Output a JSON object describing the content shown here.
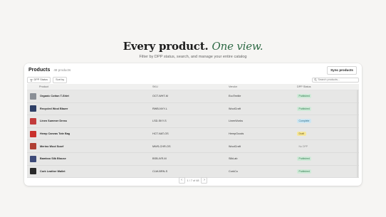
{
  "hero": {
    "title_main": "Every product.",
    "title_accent": "One view.",
    "subtitle": "Filter by DPP status, search, and manage your entire catalog"
  },
  "card": {
    "title": "Products",
    "count": "48 products",
    "sync_label": "Sync products",
    "filter_label": "DPP Status",
    "sort_label": "Sort by",
    "search_placeholder": "Search products..."
  },
  "table": {
    "headers": {
      "product": "Product",
      "sku": "SKU",
      "vendor": "Vendor",
      "status": "DPP Status"
    },
    "rows": [
      {
        "name": "Organic Cotton T-Shirt",
        "sku": "OCT-WHT-M",
        "vendor": "EcoTextile",
        "status": "Published",
        "status_kind": "published",
        "thumb_color": "#8a8f96"
      },
      {
        "name": "Recycled Wool Blazer",
        "sku": "RWB-NVY-L",
        "vendor": "WoolCraft",
        "status": "Published",
        "status_kind": "published",
        "thumb_color": "#2e3f66"
      },
      {
        "name": "Linen Summer Dress",
        "sku": "LSD-SKY-S",
        "vendor": "LinenWorks",
        "status": "Complete",
        "status_kind": "complete",
        "thumb_color": "#c23b3b"
      },
      {
        "name": "Hemp Canvas Tote Bag",
        "sku": "HCT-NAT-OS",
        "vendor": "HempGoods",
        "status": "Draft",
        "status_kind": "draft",
        "thumb_color": "#c9302c"
      },
      {
        "name": "Merino Wool Scarf",
        "sku": "MWS-CHR-OS",
        "vendor": "WoolCraft",
        "status": "No DPP",
        "status_kind": "none",
        "thumb_color": "#b04034"
      },
      {
        "name": "Bamboo Silk Blouse",
        "sku": "BSB-IVR-M",
        "vendor": "SilkLab",
        "status": "Published",
        "status_kind": "published",
        "thumb_color": "#3d4a78"
      },
      {
        "name": "Cork Leather Wallet",
        "sku": "CLW-BRN-S",
        "vendor": "CorkCo",
        "status": "Published",
        "status_kind": "published",
        "thumb_color": "#2a2a2a"
      }
    ]
  },
  "pager": {
    "info": "1 / 7 of 48",
    "prev": "‹",
    "next": "›"
  },
  "colors": {
    "accent": "#2f6b46",
    "published_bg": "#cfead8",
    "published_fg": "#2c7a4b",
    "complete_bg": "#cde6f2",
    "complete_fg": "#2a6f8e",
    "draft_bg": "#f6e79a",
    "draft_fg": "#7a6312",
    "none_fg": "#888888"
  }
}
